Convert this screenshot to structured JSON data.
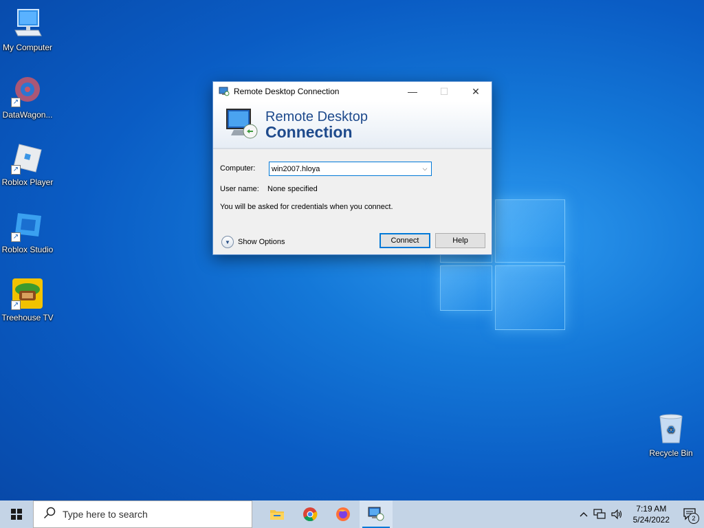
{
  "desktop": {
    "icons": [
      {
        "label": "My Computer"
      },
      {
        "label": "DataWagon..."
      },
      {
        "label": "Roblox Player"
      },
      {
        "label": "Roblox Studio"
      },
      {
        "label": "Treehouse TV"
      },
      {
        "label": "Recycle Bin"
      }
    ]
  },
  "dialog": {
    "title": "Remote Desktop Connection",
    "banner_line1": "Remote Desktop",
    "banner_line2": "Connection",
    "computer_label": "Computer:",
    "computer_value": "win2007.hloya",
    "username_label": "User name:",
    "username_value": "None specified",
    "info_text": "You will be asked for credentials when you connect.",
    "show_options": "Show Options",
    "connect_label": "Connect",
    "help_label": "Help",
    "minimize_glyph": "—",
    "maximize_glyph": "☐",
    "close_glyph": "✕"
  },
  "taskbar": {
    "search_placeholder": "Type here to search",
    "time": "7:19 AM",
    "date": "5/24/2022",
    "notification_count": "2",
    "apps": [
      "file-explorer",
      "chrome",
      "firefox",
      "remote-desktop"
    ]
  },
  "colors": {
    "accent": "#0078d7",
    "banner_text": "#1e4a8c"
  }
}
